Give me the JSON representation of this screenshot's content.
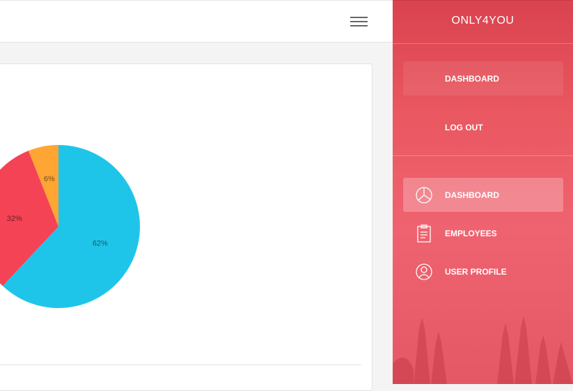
{
  "topbar": {
    "menu_icon": "hamburger-menu-icon"
  },
  "sidebar": {
    "brand": "ONLY4YOU",
    "account_items": [
      {
        "label": "DASHBOARD"
      },
      {
        "label": "LOG OUT"
      }
    ],
    "nav_items": [
      {
        "label": "DASHBOARD",
        "icon": "pie-chart-icon",
        "active": true
      },
      {
        "label": "EMPLOYEES",
        "icon": "clipboard-icon",
        "active": false
      },
      {
        "label": "USER PROFILE",
        "icon": "user-icon",
        "active": false
      }
    ]
  },
  "chart_data": {
    "type": "pie",
    "slices": [
      {
        "label": "62%",
        "value": 62,
        "color": "#1fc5e9"
      },
      {
        "label": "32%",
        "value": 32,
        "color": "#f44355"
      },
      {
        "label": "6%",
        "value": 6,
        "color": "#ffa534"
      }
    ]
  }
}
